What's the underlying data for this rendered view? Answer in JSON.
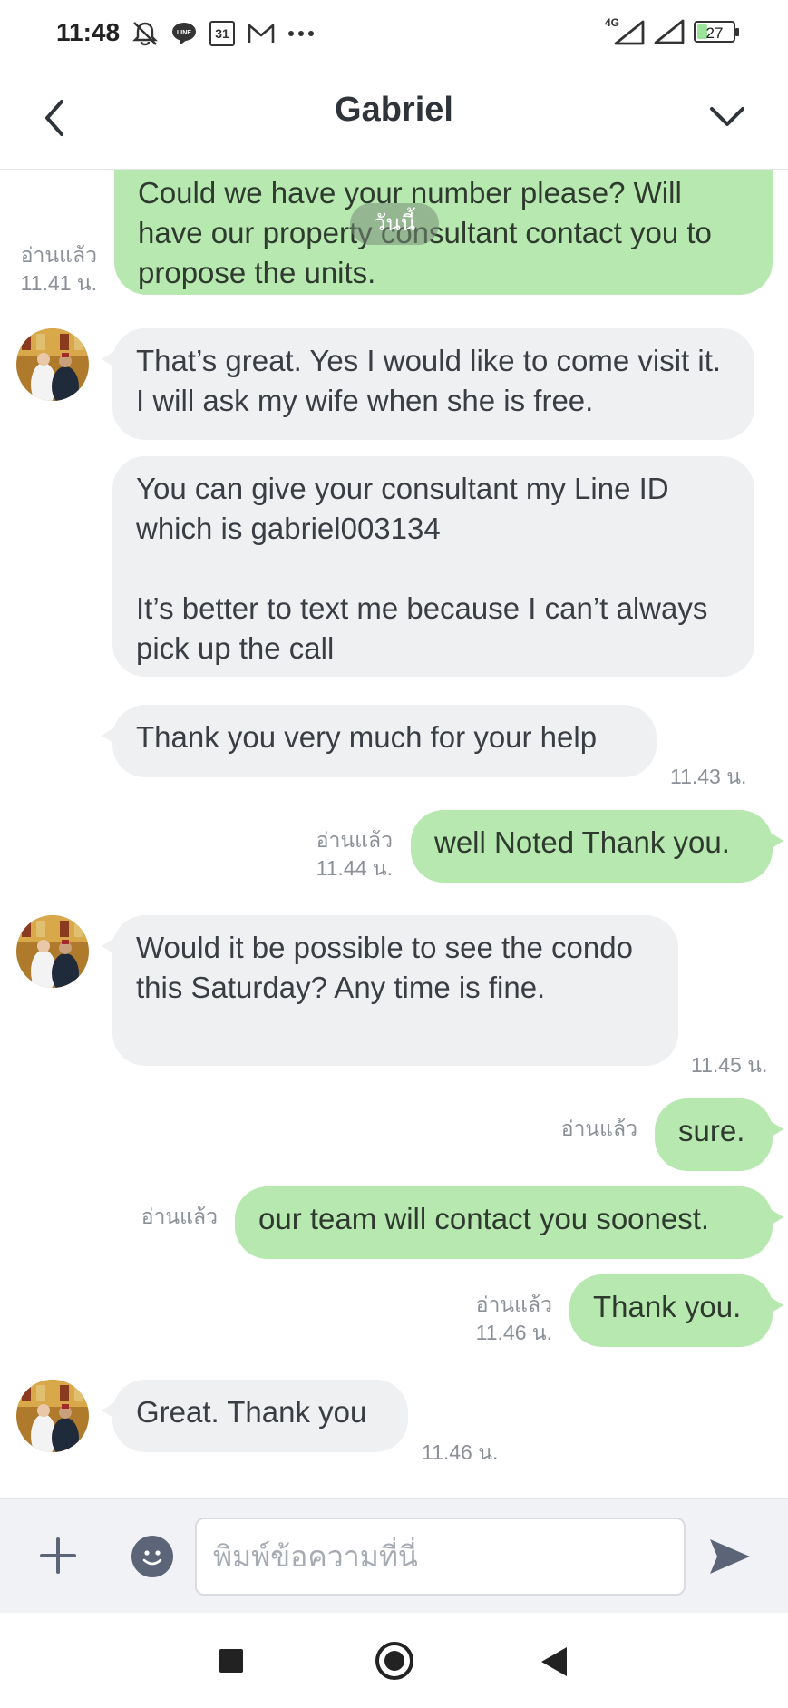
{
  "status_bar": {
    "time": "11:48",
    "icons": [
      "mute-bell-icon",
      "line-app-icon",
      "calendar-icon",
      "gmail-icon",
      "more-dots-icon"
    ],
    "calendar_day": "31",
    "network": "4G",
    "battery": "27",
    "battery_percent": 27
  },
  "header": {
    "title": "Gabriel",
    "back_icon": "chevron-left-icon",
    "menu_icon": "chevron-down-icon"
  },
  "chat": {
    "date_pill": "วันนี้",
    "messages": [
      {
        "dir": "out",
        "text": "Could we have your number please? Will have our property consultant contact you to propose the units.",
        "read": "อ่านแล้ว",
        "time": "11.41 น."
      },
      {
        "dir": "in",
        "text": "That’s great. Yes I would like to come visit it. I will ask my wife when she is free."
      },
      {
        "dir": "in",
        "text": "You can give your consultant my Line ID which is gabriel003134\n\nIt’s better to text me because I can’t always pick up the call"
      },
      {
        "dir": "in",
        "text": "Thank you very much for your help",
        "time": "11.43 น."
      },
      {
        "dir": "out",
        "text": "well Noted Thank you.",
        "read": "อ่านแล้ว",
        "time": "11.44 น."
      },
      {
        "dir": "in",
        "text": "Would it be possible to see the condo this Saturday? Any time is fine.",
        "time": "11.45 น."
      },
      {
        "dir": "out",
        "text": "sure.",
        "read": "อ่านแล้ว"
      },
      {
        "dir": "out",
        "text": "our team will contact you soonest.",
        "read": "อ่านแล้ว"
      },
      {
        "dir": "out",
        "text": "Thank you.",
        "read": "อ่านแล้ว",
        "time": "11.46 น."
      },
      {
        "dir": "in",
        "text": "Great. Thank you",
        "time": "11.46 น."
      }
    ]
  },
  "input_bar": {
    "placeholder": "พิมพ์ข้อความที่นี่",
    "plus_icon": "plus-icon",
    "emoji_icon": "emoji-icon",
    "send_icon": "send-icon"
  },
  "nav_bar": {
    "icons": [
      "recent-apps-icon",
      "home-icon",
      "back-icon"
    ]
  },
  "colors": {
    "outgoing_bubble": "#b6e8b0",
    "incoming_bubble": "#eff0f2",
    "text": "#2f343b",
    "meta_text": "#8b9097"
  }
}
